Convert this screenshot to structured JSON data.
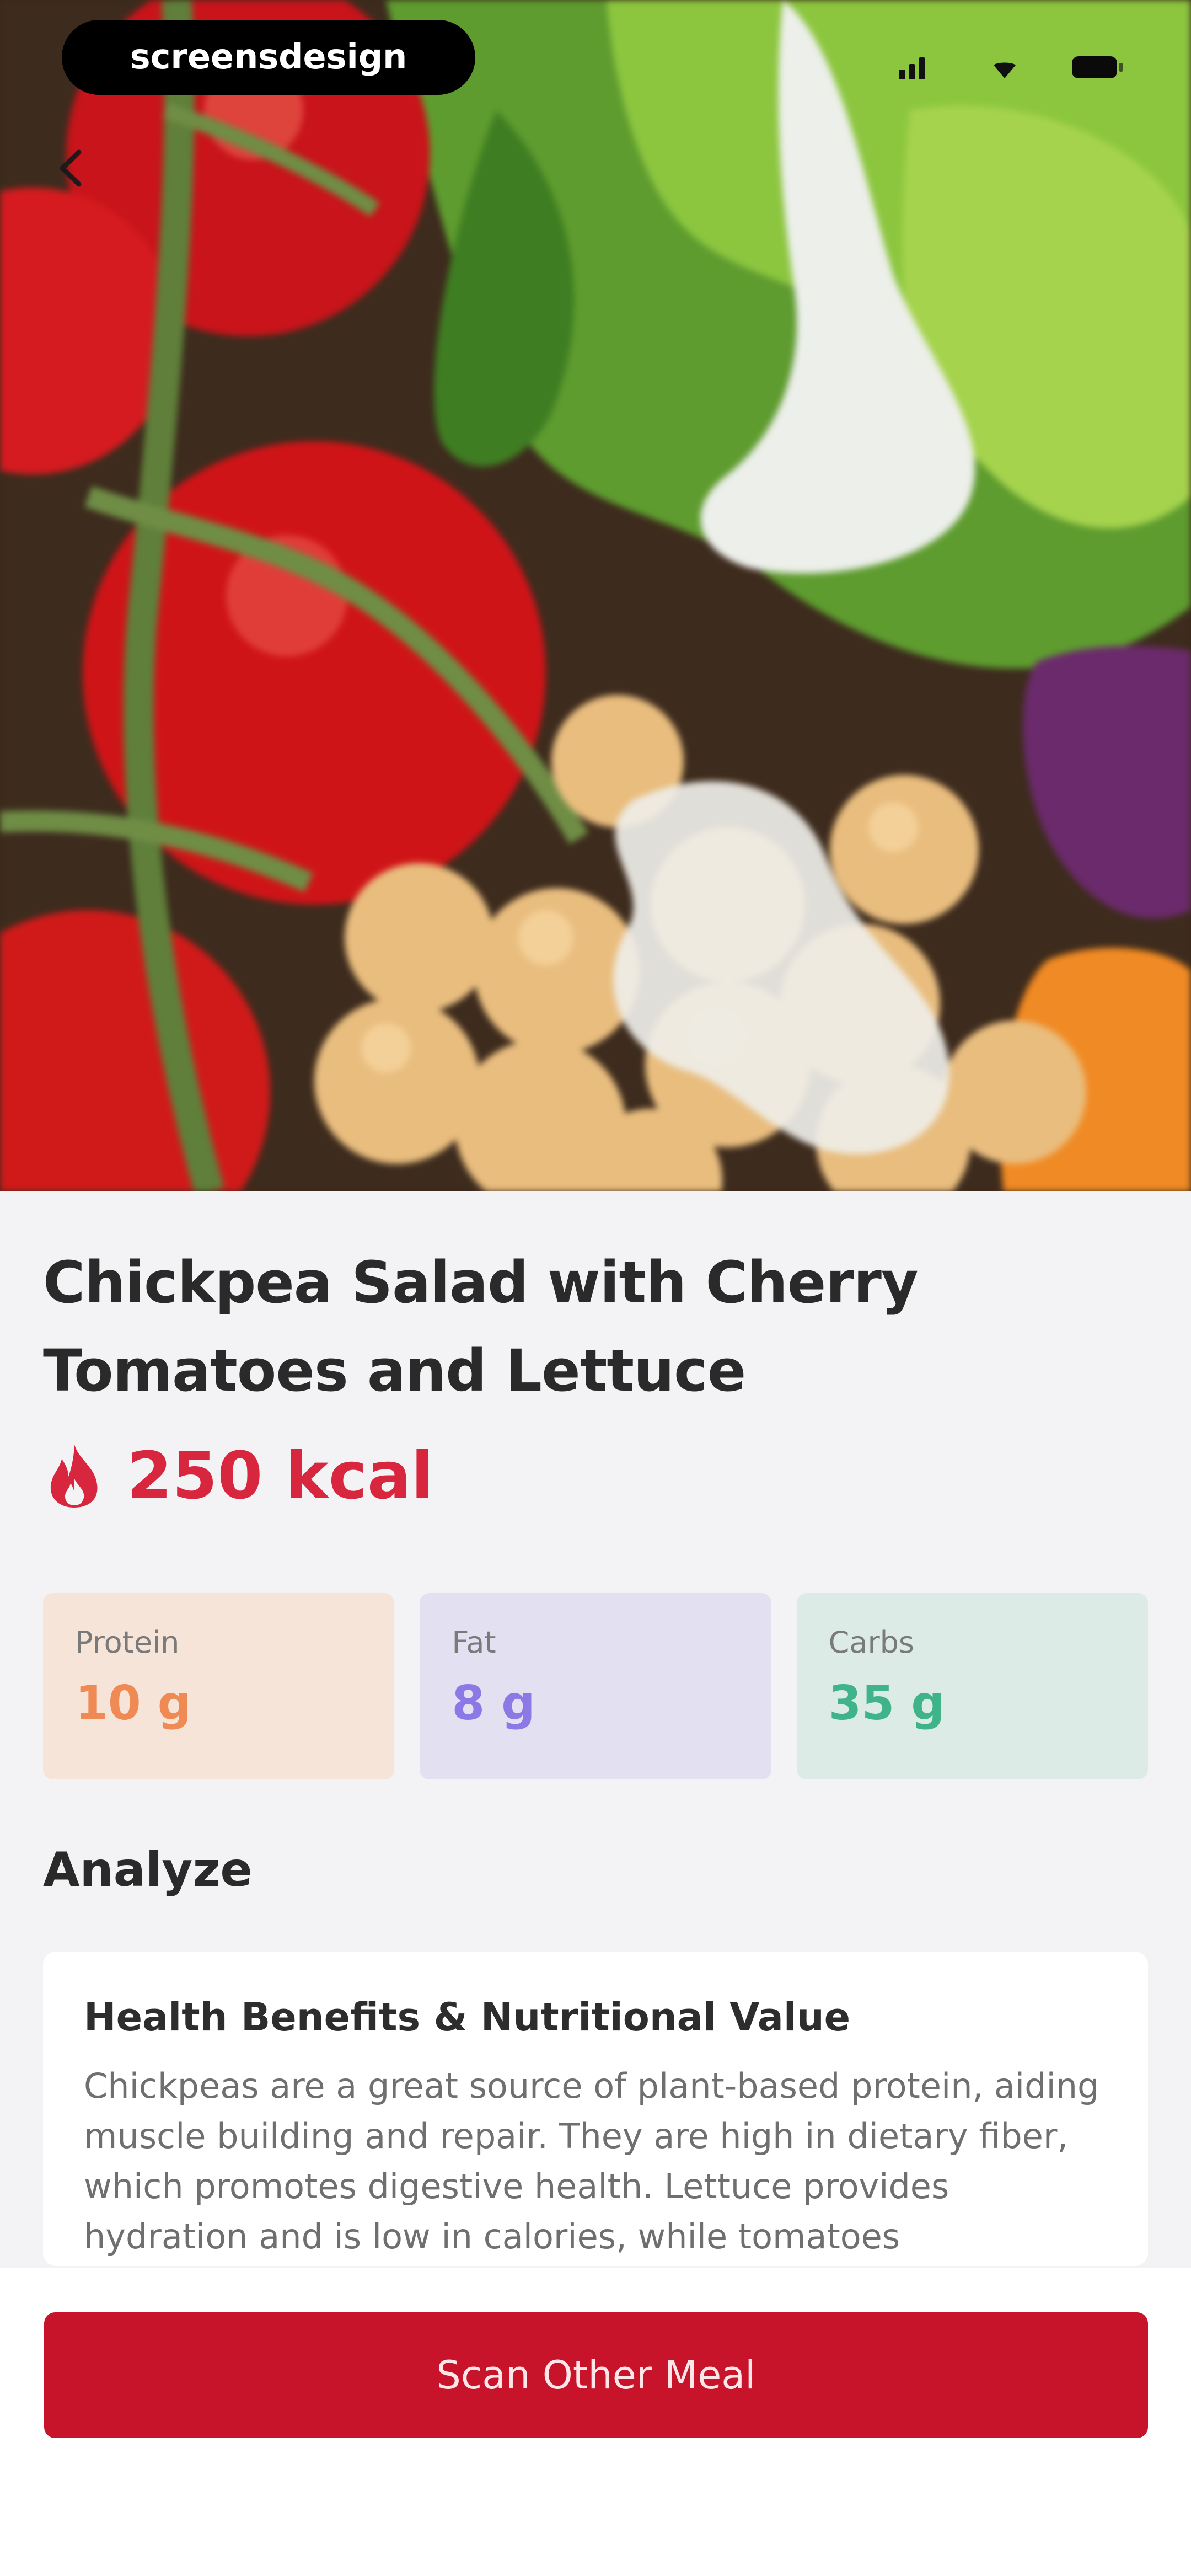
{
  "watermark": {
    "text": "screensdesign"
  },
  "meal": {
    "title": "Chickpea Salad with Cherry Tomatoes and Lettuce",
    "kcal": "250 kcal"
  },
  "macros": [
    {
      "label": "Protein",
      "value": "10 g",
      "color": "#ef8a55"
    },
    {
      "label": "Fat",
      "value": "8 g",
      "color": "#8c79e6"
    },
    {
      "label": "Carbs",
      "value": "35 g",
      "color": "#3fb48b"
    }
  ],
  "analyze": {
    "section_title": "Analyze",
    "card_title": "Health Benefits & Nutritional Value",
    "card_body": "Chickpeas are a great source of plant-based protein, aiding muscle building and repair. They are high in dietary fiber, which promotes digestive health. Lettuce provides hydration and is low in calories, while tomatoes"
  },
  "actions": {
    "scan_label": "Scan Other Meal"
  },
  "colors": {
    "accent": "#c8142a",
    "kcal": "#d7263d",
    "background": "#f3f3f5"
  },
  "icons": {
    "back": "chevron-left-icon",
    "kcal": "flame-icon",
    "signal": "signal-icon",
    "wifi": "wifi-icon",
    "battery": "battery-icon"
  }
}
